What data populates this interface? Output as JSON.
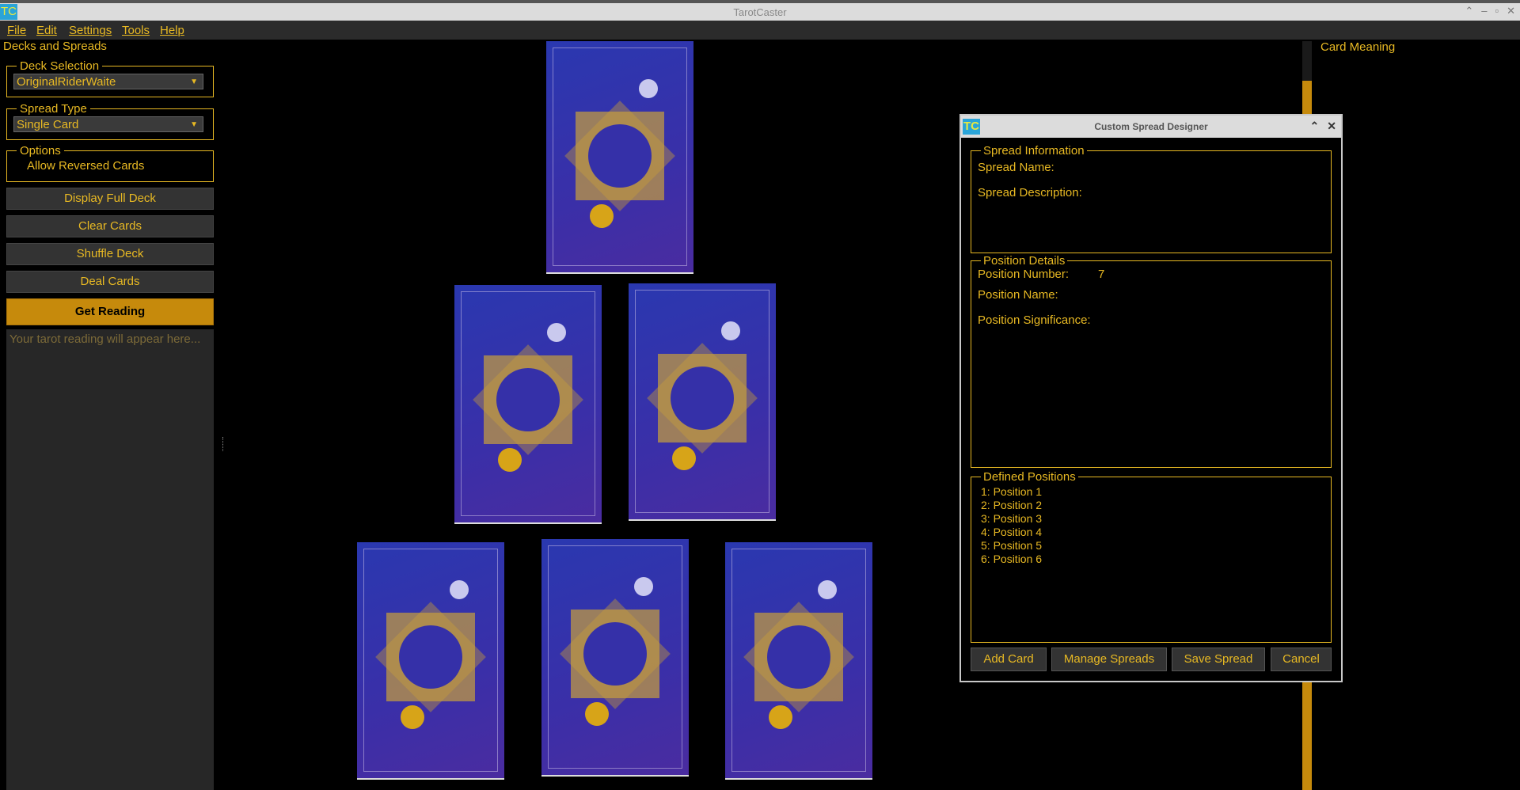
{
  "app": {
    "title": "TarotCaster",
    "logo": "TC",
    "window_controls": [
      "⌃",
      "–",
      "▫",
      "✕"
    ]
  },
  "menu": [
    "File",
    "Edit",
    "Settings",
    "Tools",
    "Help"
  ],
  "sidebar": {
    "title": "Decks and Spreads",
    "deck_selection": {
      "label": "Deck Selection",
      "value": "OriginalRiderWaite"
    },
    "spread_type": {
      "label": "Spread Type",
      "value": "Single Card"
    },
    "options": {
      "label": "Options",
      "allow_reversed": "Allow Reversed Cards"
    },
    "buttons": {
      "display_full_deck": "Display Full Deck",
      "clear_cards": "Clear Cards",
      "shuffle_deck": "Shuffle Deck",
      "deal_cards": "Deal Cards",
      "get_reading": "Get Reading"
    },
    "reading_placeholder": "Your tarot reading will appear here..."
  },
  "right_panel": {
    "title": "Card Meaning"
  },
  "dialog": {
    "title": "Custom Spread Designer",
    "logo": "TC",
    "controls": [
      "⌃",
      "✕"
    ],
    "spread_info": {
      "legend": "Spread Information",
      "name_label": "Spread Name:",
      "description_label": "Spread Description:"
    },
    "position_details": {
      "legend": "Position Details",
      "number_label": "Position Number:",
      "number_value": "7",
      "name_label": "Position Name:",
      "significance_label": "Position Significance:"
    },
    "defined_positions": {
      "legend": "Defined Positions",
      "items": [
        "1: Position 1",
        "2: Position 2",
        "3: Position 3",
        "4: Position 4",
        "5: Position 5",
        "6: Position 6"
      ]
    },
    "buttons": {
      "add_card": "Add Card",
      "manage_spreads": "Manage Spreads",
      "save_spread": "Save Spread",
      "cancel": "Cancel"
    }
  },
  "colors": {
    "accent": "#e8b923",
    "primary_button": "#c68a0c",
    "card_blue": "#2a38b0"
  }
}
